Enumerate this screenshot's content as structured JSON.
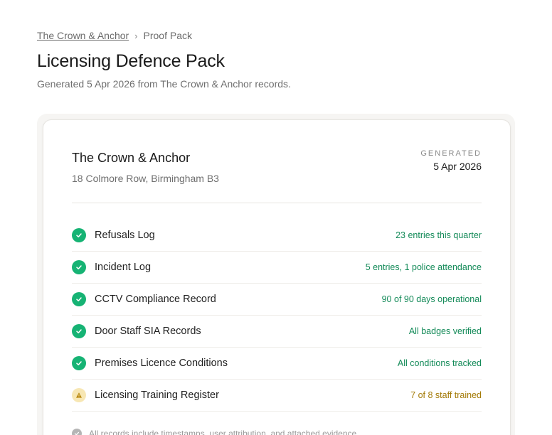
{
  "breadcrumb": {
    "venue_link": "The Crown & Anchor",
    "separator": "›",
    "current": "Proof Pack"
  },
  "page": {
    "title": "Licensing Defence Pack",
    "subtitle": "Generated 5 Apr 2026 from The Crown & Anchor records."
  },
  "card": {
    "venue_name": "The Crown & Anchor",
    "venue_address": "18 Colmore Row, Birmingham B3",
    "generated_label": "GENERATED",
    "generated_date": "5 Apr 2026",
    "items": [
      {
        "label": "Refusals Log",
        "status": "23 entries this quarter",
        "state": "ok",
        "icon": "check-icon"
      },
      {
        "label": "Incident Log",
        "status": "5 entries, 1 police attendance",
        "state": "ok",
        "icon": "check-icon"
      },
      {
        "label": "CCTV Compliance Record",
        "status": "90 of 90 days operational",
        "state": "ok",
        "icon": "check-icon"
      },
      {
        "label": "Door Staff SIA Records",
        "status": "All badges verified",
        "state": "ok",
        "icon": "check-icon"
      },
      {
        "label": "Premises Licence Conditions",
        "status": "All conditions tracked",
        "state": "ok",
        "icon": "check-icon"
      },
      {
        "label": "Licensing Training Register",
        "status": "7 of 8 staff trained",
        "state": "warn",
        "icon": "warning-icon"
      }
    ],
    "footnote": "All records include timestamps, user attribution, and attached evidence."
  },
  "colors": {
    "ok": "#16b374",
    "ok_text": "#138a58",
    "warn_bg": "#f7e7b4",
    "warn_fg": "#b8860b",
    "warn_text": "#a37a06"
  }
}
